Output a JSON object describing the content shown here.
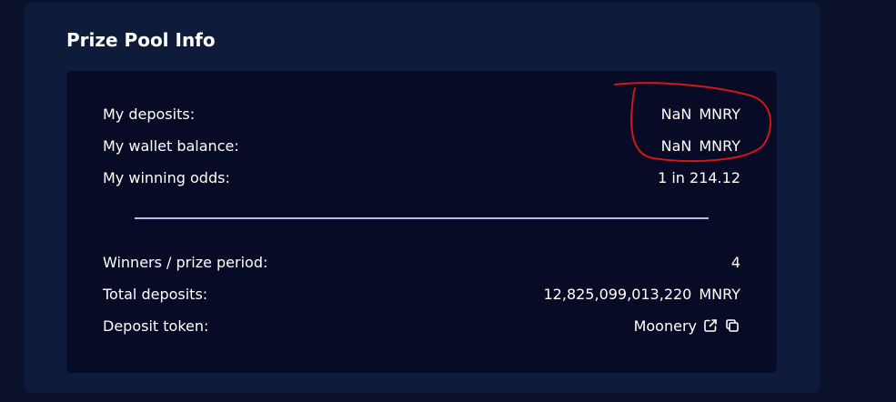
{
  "card": {
    "title": "Prize Pool Info"
  },
  "user_stats": {
    "deposits_label": "My deposits:",
    "deposits_value": "NaN",
    "deposits_unit": "MNRY",
    "wallet_label": "My wallet balance:",
    "wallet_value": "NaN",
    "wallet_unit": "MNRY",
    "odds_label": "My winning odds:",
    "odds_value": "1 in 214.12"
  },
  "pool_stats": {
    "winners_label": "Winners / prize period:",
    "winners_value": "4",
    "total_label": "Total deposits:",
    "total_value": "12,825,099,013,220",
    "total_unit": "MNRY",
    "token_label": "Deposit token:",
    "token_value": "Moonery"
  },
  "icons": {
    "external": "external-link-icon",
    "copy": "copy-icon"
  },
  "colors": {
    "background": "#0a1128",
    "card": "#0f1b3a",
    "panel": "#070b26",
    "divider": "#b8b9e6",
    "annotation": "#d01818"
  }
}
